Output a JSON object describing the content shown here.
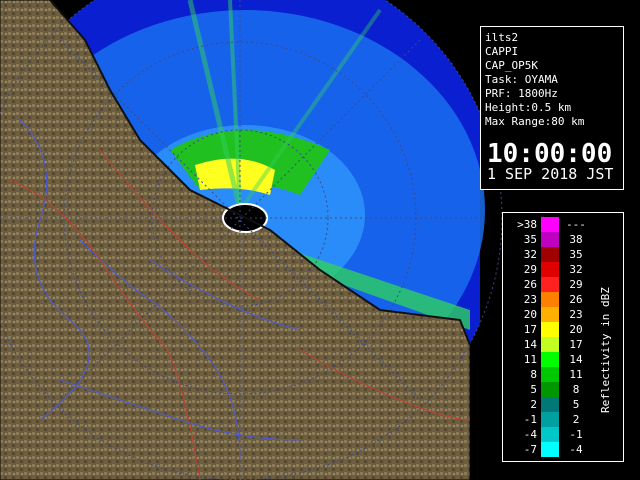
{
  "info": {
    "site": "ilts2",
    "product": "CAPPI",
    "scan": "CAP_OP5K",
    "task": "Task: OYAMA",
    "prf": "PRF: 1800Hz",
    "height": "Height:0.5 km",
    "range": "Max Range:80 km",
    "time": "10:00:00",
    "date": "1 SEP 2018 JST"
  },
  "legend": {
    "title": "Reflectivity in dBZ",
    "rows": [
      {
        "min": ">38",
        "max": "---",
        "color": "#ff00ff"
      },
      {
        "min": "35",
        "max": "38",
        "color": "#c000c0"
      },
      {
        "min": "32",
        "max": "35",
        "color": "#a00000"
      },
      {
        "min": "29",
        "max": "32",
        "color": "#e00000"
      },
      {
        "min": "26",
        "max": "29",
        "color": "#ff2020"
      },
      {
        "min": "23",
        "max": "26",
        "color": "#ff8000"
      },
      {
        "min": "20",
        "max": "23",
        "color": "#ffb000"
      },
      {
        "min": "17",
        "max": "20",
        "color": "#ffff00"
      },
      {
        "min": "14",
        "max": "17",
        "color": "#c0ff20"
      },
      {
        "min": "11",
        "max": "14",
        "color": "#00ff00"
      },
      {
        "min": "8",
        "max": "11",
        "color": "#00c800"
      },
      {
        "min": "5",
        "max": "8",
        "color": "#009600"
      },
      {
        "min": "2",
        "max": "5",
        "color": "#007878"
      },
      {
        "min": "-1",
        "max": "2",
        "color": "#00a0a0"
      },
      {
        "min": "-4",
        "max": "-1",
        "color": "#00c8c8"
      },
      {
        "min": "-7",
        "max": "-4",
        "color": "#00ffff"
      }
    ]
  },
  "colors": {
    "sea": "#0a1fd0",
    "land": "#7a6a4a",
    "echo_light": "#1070f0"
  }
}
